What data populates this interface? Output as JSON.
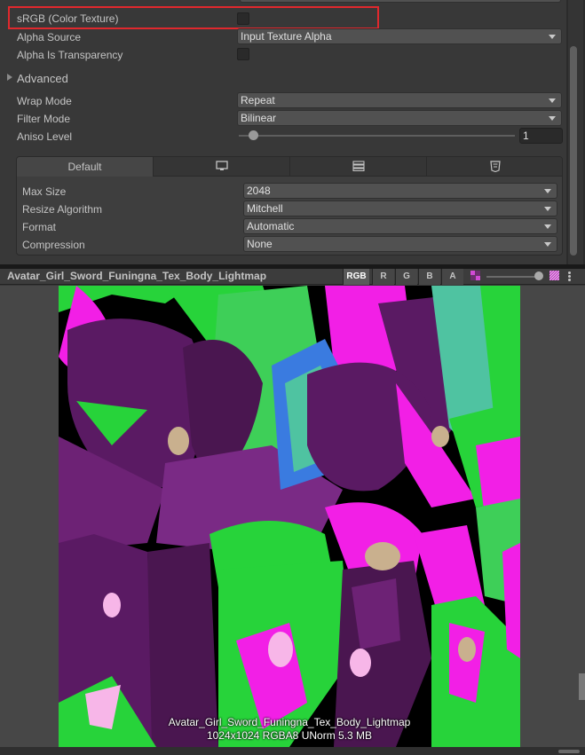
{
  "inspector": {
    "srgb": {
      "label": "sRGB (Color Texture)",
      "checked": false
    },
    "alpha_source": {
      "label": "Alpha Source",
      "value": "Input Texture Alpha"
    },
    "alpha_is_transparency": {
      "label": "Alpha Is Transparency",
      "checked": false
    },
    "advanced": {
      "label": "Advanced",
      "expanded": false
    },
    "wrap_mode": {
      "label": "Wrap Mode",
      "value": "Repeat"
    },
    "filter_mode": {
      "label": "Filter Mode",
      "value": "Bilinear"
    },
    "aniso_level": {
      "label": "Aniso Level",
      "value": "1",
      "slider_fraction": 0.05
    }
  },
  "platform": {
    "tabs": [
      {
        "label": "Default",
        "icon": "",
        "active": true
      },
      {
        "label": "",
        "icon": "monitor-icon",
        "active": false
      },
      {
        "label": "",
        "icon": "server-icon",
        "active": false
      },
      {
        "label": "",
        "icon": "html5-icon",
        "active": false
      }
    ],
    "max_size": {
      "label": "Max Size",
      "value": "2048"
    },
    "resize_algorithm": {
      "label": "Resize Algorithm",
      "value": "Mitchell"
    },
    "format": {
      "label": "Format",
      "value": "Automatic"
    },
    "compression": {
      "label": "Compression",
      "value": "None"
    }
  },
  "preview": {
    "title": "Avatar_Girl_Sword_Funingna_Tex_Body_Lightmap",
    "channels": [
      "RGB",
      "R",
      "G",
      "B",
      "A"
    ],
    "active_channel": "RGB",
    "mip_level_fraction": 1.0,
    "info_line1": "Avatar_Girl_Sword_Funingna_Tex_Body_Lightmap",
    "info_line2": "1024x1024  RGBA8 UNorm  5.3 MB"
  },
  "colors": {
    "highlight": "#e0282d",
    "texture_green": "#27d33a",
    "texture_magenta": "#f21fe6",
    "texture_purple": "#5a1a63",
    "texture_teal": "#4fc3a1"
  }
}
